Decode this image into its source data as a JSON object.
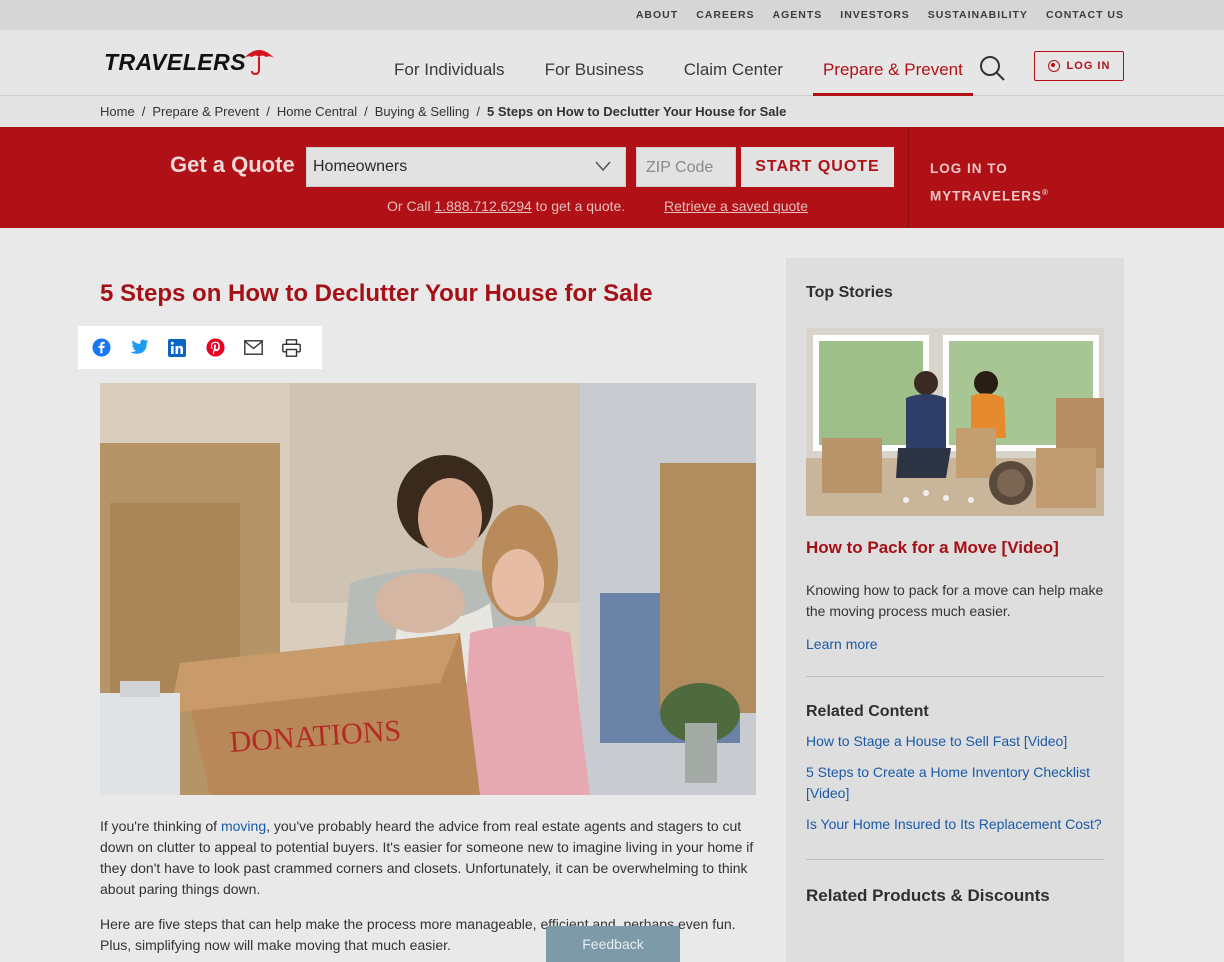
{
  "utility": [
    "ABOUT",
    "CAREERS",
    "AGENTS",
    "INVESTORS",
    "SUSTAINABILITY",
    "CONTACT US"
  ],
  "brand": {
    "name": "TRAVELERS",
    "accent": "#b11117"
  },
  "nav": [
    "For Individuals",
    "For Business",
    "Claim Center",
    "Prepare & Prevent"
  ],
  "header": {
    "login": "LOG IN"
  },
  "breadcrumb": [
    "Home",
    "Prepare & Prevent",
    "Home Central",
    "Buying & Selling",
    "5 Steps on How to Declutter Your House for Sale"
  ],
  "quote": {
    "title": "Get a Quote",
    "product": "Homeowners",
    "zip_placeholder": "ZIP Code",
    "start": "START QUOTE",
    "call_prefix": "Or Call",
    "phone": "1.888.712.6294",
    "call_suffix": "to get a quote.",
    "retrieve": "Retrieve a saved quote",
    "mytravelers_line1": "LOG IN TO",
    "mytravelers_line2": "MYTRAVELERS",
    "reg": "®"
  },
  "article": {
    "title": "5 Steps on How to Declutter Your House for Sale",
    "box_label": "DONATIONS",
    "p1_before": "If you're thinking of",
    "p1_link": "moving",
    "p1_after": ", you've probably heard the advice from real estate agents and stagers to cut down on clutter to appeal to potential buyers. It's easier for someone new to imagine living in your home if they don't have to look past crammed corners and closets. Unfortunately, it can be overwhelming to think about paring things down.",
    "p2": "Here are five steps that can help make the process more manageable, efficient and, perhaps even fun. Plus, simplifying now will make moving that much easier."
  },
  "sidebar": {
    "top_stories": "Top Stories",
    "story_title": "How to Pack for a Move [Video]",
    "story_desc": "Knowing how to pack for a move can help make the moving process much easier.",
    "learn_more": "Learn more",
    "related_heading": "Related Content",
    "related": [
      "How to Stage a House to Sell Fast [Video]",
      "5 Steps to Create a Home Inventory Checklist [Video]",
      "Is Your Home Insured to Its Replacement Cost?"
    ],
    "products_heading": "Related Products & Discounts"
  },
  "feedback": "Feedback"
}
